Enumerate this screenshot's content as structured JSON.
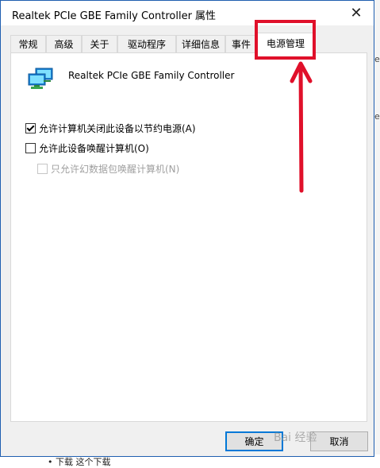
{
  "window": {
    "title": "Realtek PCIe GBE Family Controller 属性",
    "close_glyph": "✕"
  },
  "tabs": [
    {
      "label": "常规"
    },
    {
      "label": "高级"
    },
    {
      "label": "关于"
    },
    {
      "label": "驱动程序"
    },
    {
      "label": "详细信息"
    },
    {
      "label": "事件"
    },
    {
      "label": "电源管理",
      "active": true
    }
  ],
  "panel": {
    "device_name": "Realtek PCIe GBE Family Controller",
    "device_icon": "network-adapter-icon",
    "options": [
      {
        "label": "允许计算机关闭此设备以节约电源(A)",
        "checked": true,
        "enabled": true
      },
      {
        "label": "允许此设备唤醒计算机(O)",
        "checked": false,
        "enabled": true
      },
      {
        "label": "只允许幻数据包唤醒计算机(N)",
        "checked": false,
        "enabled": false
      }
    ]
  },
  "buttons": {
    "ok": "确定",
    "cancel": "取消"
  },
  "background": {
    "below_text": "• 下载     这个下载",
    "right_fragment_1": "e",
    "right_fragment_2": "e"
  },
  "annotation": {
    "color": "#e0102a",
    "watermark": "Bai 经验"
  },
  "colors": {
    "accent": "#0078d7",
    "dialog_bg": "#f0f0f0",
    "window_border": "#1f5fb0"
  }
}
